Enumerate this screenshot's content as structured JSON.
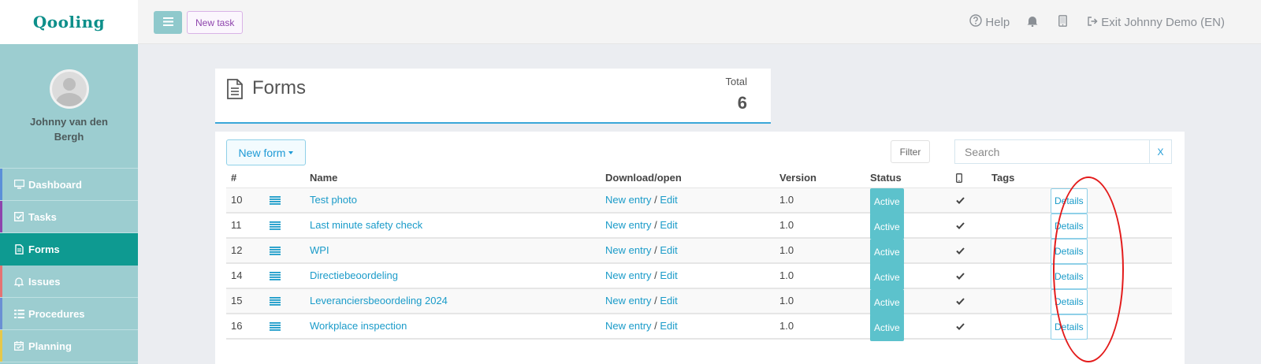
{
  "app": {
    "logo": "Qooling",
    "accent": "#0e9a91"
  },
  "topbar": {
    "new_task_label": "New task",
    "help_label": "Help",
    "exit_label": "Exit Johnny Demo (EN)"
  },
  "sidebar": {
    "username": "Johnny van den Bergh",
    "items": [
      {
        "label": "Dashboard",
        "icon": "monitor-icon",
        "color": "#5b8fd9"
      },
      {
        "label": "Tasks",
        "icon": "check-square-icon",
        "color": "#8e44ad"
      },
      {
        "label": "Forms",
        "icon": "document-icon",
        "color": "#0e9a91"
      },
      {
        "label": "Issues",
        "icon": "bell-icon",
        "color": "#e57373"
      },
      {
        "label": "Procedures",
        "icon": "list-icon",
        "color": "#6a8fd4"
      },
      {
        "label": "Planning",
        "icon": "calendar-icon",
        "color": "#e6c84a"
      }
    ]
  },
  "header": {
    "title": "Forms",
    "total_label": "Total",
    "total_value": "6"
  },
  "toolbar": {
    "new_form_label": "New form",
    "filter_label": "Filter",
    "search_placeholder": "Search",
    "clear_label": "X"
  },
  "table": {
    "columns": [
      "#",
      "Name",
      "Download/open",
      "Version",
      "Status",
      "Tags"
    ],
    "new_entry_label": "New entry",
    "edit_label": "Edit",
    "details_label": "Details",
    "rows": [
      {
        "id": "10",
        "name": "Test photo",
        "version": "1.0",
        "status": "Active"
      },
      {
        "id": "11",
        "name": "Last minute safety check",
        "version": "1.0",
        "status": "Active"
      },
      {
        "id": "12",
        "name": "WPI",
        "version": "1.0",
        "status": "Active"
      },
      {
        "id": "14",
        "name": "Directiebeoordeling",
        "version": "1.0",
        "status": "Active"
      },
      {
        "id": "15",
        "name": "Leveranciersbeoordeling 2024",
        "version": "1.0",
        "status": "Active"
      },
      {
        "id": "16",
        "name": "Workplace inspection",
        "version": "1.0",
        "status": "Active"
      }
    ]
  }
}
